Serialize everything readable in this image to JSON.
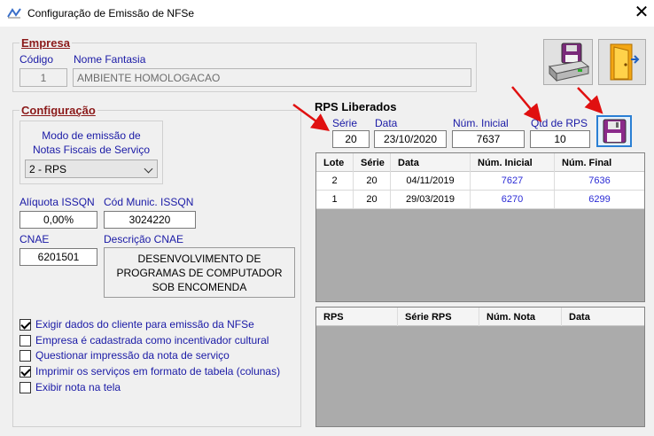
{
  "window": {
    "title": "Configuração de Emissão de NFSe",
    "close_glyph": "✕"
  },
  "empresa": {
    "section_title": "Empresa",
    "codigo_label": "Código",
    "codigo_value": "1",
    "fantasia_label": "Nome Fantasia",
    "fantasia_value": "AMBIENTE HOMOLOGACAO"
  },
  "configuracao": {
    "section_title": "Configuração",
    "modo_label_1": "Modo de emissão de",
    "modo_label_2": "Notas Fiscais de Serviço",
    "modo_value": "2 - RPS",
    "aliquota_label": "Alíquota ISSQN",
    "aliquota_value": "0,00%",
    "cod_munic_label": "Cód Munic. ISSQN",
    "cod_munic_value": "3024220",
    "cnae_label": "CNAE",
    "cnae_value": "6201501",
    "desc_cnae_label": "Descrição CNAE",
    "desc_cnae_line1": "DESENVOLVIMENTO DE",
    "desc_cnae_line2": "PROGRAMAS DE COMPUTADOR",
    "desc_cnae_line3": "SOB ENCOMENDA"
  },
  "options": [
    {
      "label": "Exigir dados do cliente para emissão da NFSe",
      "checked": true
    },
    {
      "label": "Empresa é cadastrada como incentivador cultural",
      "checked": false
    },
    {
      "label": "Questionar impressão da nota de serviço",
      "checked": false
    },
    {
      "label": "Imprimir os serviços em formato de tabela (colunas)",
      "checked": true
    },
    {
      "label": "Exibir nota na tela",
      "checked": false
    }
  ],
  "rps": {
    "section_title": "RPS Liberados",
    "serie_label": "Série",
    "serie_value": "20",
    "data_label": "Data",
    "data_value": "23/10/2020",
    "num_inicial_label": "Núm. Inicial",
    "num_inicial_value": "7637",
    "qtd_label": "Qtd de RPS",
    "qtd_value": "10"
  },
  "lotes_table": {
    "headers": [
      "Lote",
      "Série",
      "Data",
      "Núm. Inicial",
      "Núm. Final"
    ],
    "rows": [
      [
        "2",
        "20",
        "04/11/2019",
        "7627",
        "7636"
      ],
      [
        "1",
        "20",
        "29/03/2019",
        "6270",
        "6299"
      ]
    ]
  },
  "rps_table": {
    "headers": [
      "RPS",
      "Série RPS",
      "Núm. Nota",
      "Data"
    ]
  },
  "colors": {
    "annotation_arrow": "#e01010",
    "section_title": "#8b1a1a",
    "label_blue": "#1a1aa6",
    "grid_bg": "#ababab"
  },
  "icons": [
    "nfse-app-icon",
    "save-disk-printer-icon",
    "exit-door-icon",
    "save-disk-icon"
  ]
}
